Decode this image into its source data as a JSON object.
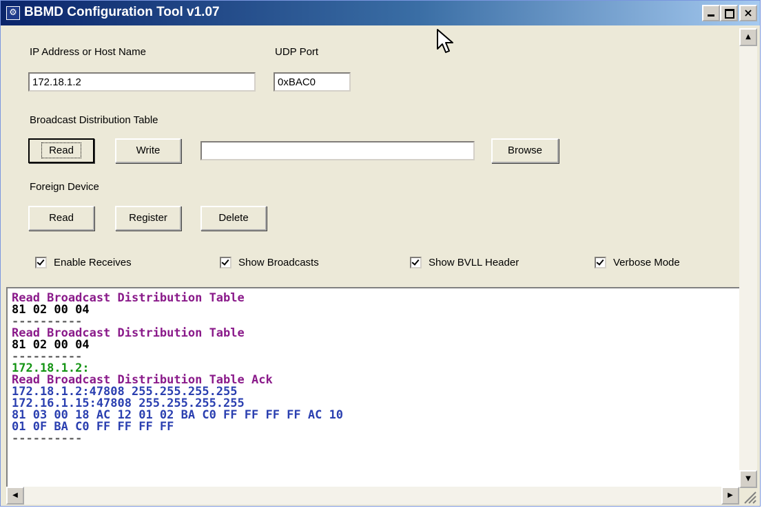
{
  "window": {
    "title": "BBMD Configuration Tool v1.07",
    "app_icon": "app-icon",
    "controls": {
      "minimize": "minimize-icon",
      "maximize": "maximize-icon",
      "close": "×"
    }
  },
  "connection": {
    "ip_label": "IP Address or Host Name",
    "ip_value": "172.18.1.2",
    "udp_label": "UDP Port",
    "udp_value": "0xBAC0"
  },
  "bdt": {
    "label": "Broadcast Distribution Table",
    "read_label": "Read",
    "write_label": "Write",
    "file_value": "",
    "browse_label": "Browse"
  },
  "foreign_device": {
    "label": "Foreign Device",
    "read_label": "Read",
    "register_label": "Register",
    "delete_label": "Delete"
  },
  "options": [
    {
      "label": "Enable Receives",
      "checked": true
    },
    {
      "label": "Show Broadcasts",
      "checked": true
    },
    {
      "label": "Show BVLL Header",
      "checked": true
    },
    {
      "label": "Verbose Mode",
      "checked": true
    }
  ],
  "log": [
    {
      "text": "Read Broadcast Distribution Table",
      "color": "#8a1a8a"
    },
    {
      "text": "81 02 00 04",
      "color": "#000000"
    },
    {
      "text": "----------",
      "color": "#666666"
    },
    {
      "text": "Read Broadcast Distribution Table",
      "color": "#8a1a8a"
    },
    {
      "text": "81 02 00 04",
      "color": "#000000"
    },
    {
      "text": "----------",
      "color": "#666666"
    },
    {
      "text": "172.18.1.2:",
      "color": "#149414"
    },
    {
      "text": "Read Broadcast Distribution Table Ack",
      "color": "#8a1a8a"
    },
    {
      "text": "172.18.1.2:47808 255.255.255.255",
      "color": "#2a3fb0"
    },
    {
      "text": "172.16.1.15:47808 255.255.255.255",
      "color": "#2a3fb0"
    },
    {
      "text": "81 03 00 18 AC 12 01 02 BA C0 FF FF FF FF AC 10",
      "color": "#2a3fb0"
    },
    {
      "text": "01 0F BA C0 FF FF FF FF",
      "color": "#2a3fb0"
    },
    {
      "text": "----------",
      "color": "#666666"
    }
  ],
  "scrollbars": {
    "up": "▲",
    "down": "▼",
    "left": "◀",
    "right": "▶"
  },
  "colors": {
    "titlebar": "#0a246a",
    "face": "#ece9d8",
    "log_request": "#8a1a8a",
    "log_source": "#149414",
    "log_data": "#2a3fb0"
  }
}
